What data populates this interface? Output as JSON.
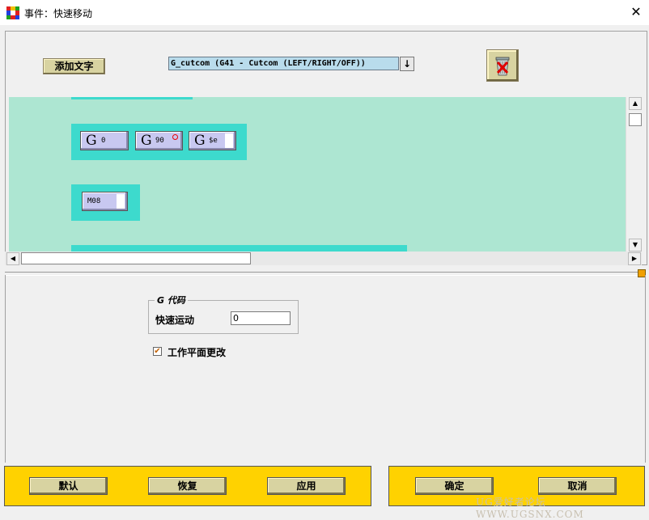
{
  "window": {
    "title": "事件：快速移动",
    "close_icon": "✕"
  },
  "toolbar": {
    "add_text_label": "添加文字",
    "select_value": "G_cutcom (G41 - Cutcom (LEFT/RIGHT/OFF))",
    "select_arrow": "↓"
  },
  "canvas": {
    "bg_color": "#ade6d2",
    "accent_color": "#3ddacd",
    "row1": [
      {
        "big": "G",
        "small": "0"
      },
      {
        "big": "G",
        "small": "90"
      },
      {
        "big": "G",
        "small": "$e"
      }
    ],
    "row2": [
      {
        "small": "M08"
      }
    ]
  },
  "params": {
    "group_title": "G 代码",
    "rapid_label": "快速运动",
    "rapid_value": "0",
    "workplane_label": "工作平面更改",
    "workplane_checked": true,
    "check_mark": "✔"
  },
  "buttons": {
    "default_label": "默认",
    "restore_label": "恢复",
    "apply_label": "应用",
    "ok_label": "确定",
    "cancel_label": "取消"
  },
  "watermark": "UG爱好者论坛 WWW.UGSNX.COM",
  "colors": {
    "button_bar": "#ffd200",
    "button": "#d8d3a1"
  }
}
